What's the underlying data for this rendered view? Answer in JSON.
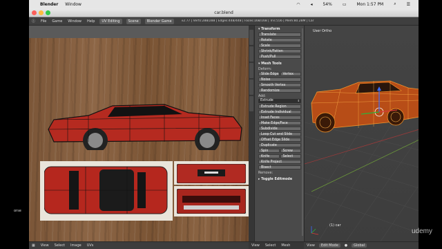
{
  "os_menubar": {
    "apple_glyph": "",
    "app_name": "Blender",
    "menu": [
      "Window"
    ],
    "battery": "54%",
    "clock": "Mon 1:57 PM"
  },
  "window": {
    "title": "car.blend"
  },
  "blender_header": {
    "menus": [
      "File",
      "Game",
      "Window",
      "Help"
    ],
    "layout": "UV Editing",
    "scene": "Scene",
    "engine": "Blender Game",
    "stats": "v2.77 | Verts:288/288 | Edges:448/448 | Faces:168/168 | Tris:556 | Mem:80.28M | Car"
  },
  "toolshelf": {
    "transform_title": "Transform",
    "transform_buttons": [
      "Translate",
      "Rotate",
      "Scale",
      "Shrink/Fatten",
      "Push/Pull"
    ],
    "mesh_tools_title": "Mesh Tools",
    "deform_label": "Deform:",
    "slide_edge": "Slide Edge",
    "vertex": "Vertex",
    "noise": "Noise",
    "smooth_vertex": "Smooth Vertex",
    "randomize": "Randomize",
    "add_label": "Add:",
    "extrude_select": "Extrude",
    "add_buttons": [
      "Extrude Region",
      "Extrude Individual",
      "Inset Faces",
      "Make Edge/Face",
      "Subdivide",
      "Loop Cut and Slide",
      "Offset Edge Slide",
      "Duplicate"
    ],
    "spin": "Spin",
    "screw": "Screw",
    "knife": "Knife",
    "select": "Select",
    "knife_project": "Knife Project",
    "bisect": "Bisect",
    "remove_label": "Remove:",
    "toggle_editmode": "Toggle Editmode"
  },
  "viewport": {
    "view_label": "User Ortho",
    "object_label": "(1) car"
  },
  "bottom_left": [
    "View",
    "Select",
    "Image",
    "UVs"
  ],
  "bottom_mid": [
    "View",
    "Select",
    "Mesh"
  ],
  "bottom_right": {
    "view": "View",
    "mode": "Edit Mode",
    "pivot": "Global"
  },
  "watermark": "udemy",
  "left_cutoff_text": "orse"
}
